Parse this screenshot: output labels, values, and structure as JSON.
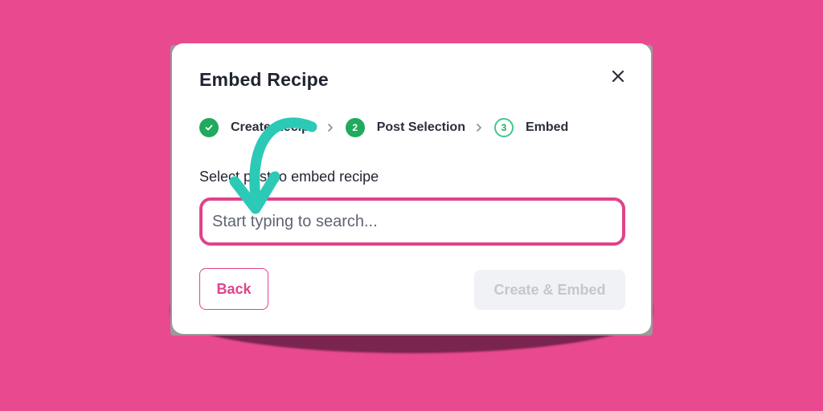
{
  "modal": {
    "title": "Embed Recipe",
    "close_icon": "close-icon"
  },
  "steps": [
    {
      "number": "",
      "label": "Create Recipe",
      "state": "done",
      "icon": "check-icon"
    },
    {
      "number": "2",
      "label": "Post Selection",
      "state": "active"
    },
    {
      "number": "3",
      "label": "Embed",
      "state": "pending"
    }
  ],
  "form": {
    "label": "Select post to embed recipe",
    "search_placeholder": "Start typing to search...",
    "search_value": ""
  },
  "buttons": {
    "back_label": "Back",
    "create_label": "Create & Embed"
  },
  "colors": {
    "background": "#e94a8f",
    "accent": "#e0438b",
    "success": "#1faa5e",
    "annotation_arrow": "#2cc9b7"
  },
  "annotation": {
    "icon": "curved-arrow-icon"
  }
}
